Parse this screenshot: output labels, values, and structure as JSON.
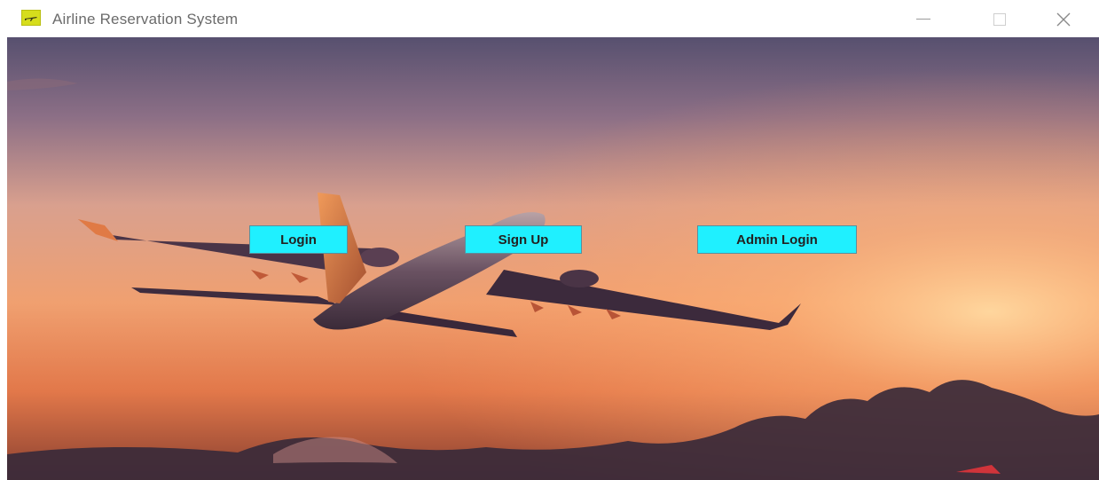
{
  "window": {
    "title": "Airline Reservation System",
    "icons": {
      "app": "airplane-app-icon",
      "minimize": "minimize-icon",
      "maximize": "maximize-icon",
      "close": "close-icon"
    }
  },
  "main": {
    "buttons": {
      "login": "Login",
      "signup": "Sign Up",
      "admin_login": "Admin Login"
    },
    "background": "sunset-airplane-photo"
  },
  "colors": {
    "button_bg": "#1ff0ff",
    "app_icon": "#d6dd1c"
  }
}
